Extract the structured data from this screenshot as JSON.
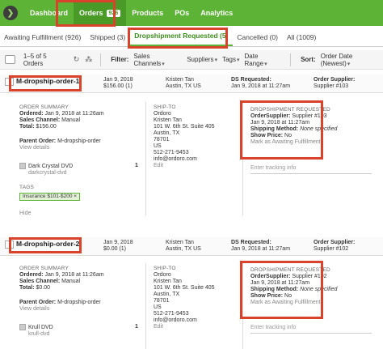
{
  "nav": {
    "items": [
      "Dashboard",
      "Orders",
      "Products",
      "POs",
      "Analytics"
    ],
    "orders_badge": "926",
    "logo_glyph": "❯"
  },
  "tabs": [
    "Awaiting Fulfillment (926)",
    "Shipped (3)",
    "Dropshipment Requested (5)",
    "Cancelled (0)",
    "All (1009)"
  ],
  "toolbar": {
    "range": "1–5 of 5 Orders",
    "filter_label": "Filter:",
    "filters": [
      "Sales Channels",
      "Suppliers",
      "Tags",
      "Date Range"
    ],
    "sort_label": "Sort:",
    "sort_value": "Order Date (Newest)"
  },
  "colors": {
    "nav_green": "#5cb335",
    "highlight_red": "#d9432b"
  },
  "orders": [
    {
      "id": "M-dropship-order-1",
      "date": "Jan 9, 2018",
      "total": "$156.00 (1)",
      "customer": "Kristen Tan",
      "location": "Austin, TX US",
      "ds_requested_label": "DS Requested:",
      "ds_requested": "Jan 9, 2018 at 11:27am",
      "supplier_label": "Order Supplier:",
      "supplier": "Supplier #103",
      "summary": {
        "title": "ORDER SUMMARY",
        "ordered_label": "Ordered:",
        "ordered": "Jan 9, 2018 at 11:26am",
        "channel_label": "Sales Channel:",
        "channel": "Manual",
        "total_label": "Total:",
        "total": "$156.00",
        "parent_label": "Parent Order:",
        "parent": "M-dropship-order",
        "view_details": "View details",
        "item_name": "Dark Crystal DVD",
        "item_sku": "darkcrystal-dvd",
        "item_qty": "1",
        "tags_title": "TAGS",
        "tag": "Insurance $101-$200 ×",
        "hide": "Hide"
      },
      "shipto": {
        "title": "SHIP-TO",
        "lines": [
          "Ordoro",
          "Kristen Tan",
          "101 W. 6th St. Suite 405",
          "Austin, TX",
          "78701",
          "US",
          "512-271-9453",
          "info@ordoro.com"
        ],
        "edit": "Edit"
      },
      "dropship": {
        "title": "DROPSHIPMENT REQUESTED",
        "supplier_label": "OrderSupplier:",
        "supplier": "Supplier #103",
        "date": "Jan 9, 2018 at 11:27am",
        "method_label": "Shipping Method:",
        "method": "None specified",
        "price_label": "Show Price:",
        "price": "No",
        "mark": "Mark as Awaiting Fulfillment",
        "tracking": "Enter tracking info"
      }
    },
    {
      "id": "M-dropship-order-2",
      "date": "Jan 9, 2018",
      "total": "$0.00 (1)",
      "customer": "Kristen Tan",
      "location": "Austin, TX US",
      "ds_requested_label": "DS Requested:",
      "ds_requested": "Jan 9, 2018 at 11:27am",
      "supplier_label": "Order Supplier:",
      "supplier": "Supplier #102",
      "summary": {
        "title": "ORDER SUMMARY",
        "ordered_label": "Ordered:",
        "ordered": "Jan 9, 2018 at 11:26am",
        "channel_label": "Sales Channel:",
        "channel": "Manual",
        "total_label": "Total:",
        "total": "$0.00",
        "parent_label": "Parent Order:",
        "parent": "M-dropship-order",
        "view_details": "View details",
        "item_name": "Krull DVD",
        "item_sku": "krull-dvd",
        "item_qty": "1"
      },
      "shipto": {
        "title": "SHIP-TO",
        "lines": [
          "Ordoro",
          "Kristen Tan",
          "101 W. 6th St. Suite 405",
          "Austin, TX",
          "78701",
          "US",
          "512-271-9453",
          "info@ordoro.com"
        ],
        "edit": "Edit"
      },
      "dropship": {
        "title": "DROPSHIPMENT REQUESTED",
        "supplier_label": "OrderSupplier:",
        "supplier": "Supplier #102",
        "date": "Jan 9, 2018 at 11:27am",
        "method_label": "Shipping Method:",
        "method": "None specified",
        "price_label": "Show Price:",
        "price": "No",
        "mark": "Mark as Awaiting Fulfillment",
        "tracking": "Enter tracking info"
      }
    }
  ]
}
